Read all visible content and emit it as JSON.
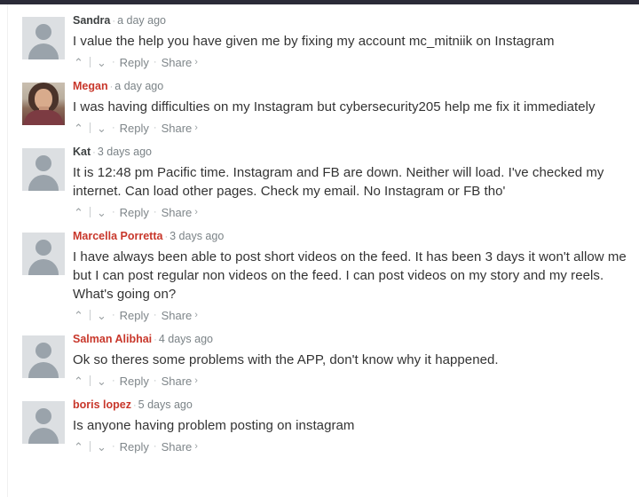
{
  "page": {
    "title": "Comment thread",
    "accent_red": "#c8372b",
    "text_color": "#333333",
    "meta_color": "#7b8387",
    "top_strip_color": "#2b2b38"
  },
  "actions": {
    "upvote_icon": "chevron-up-icon",
    "downvote_icon": "chevron-down-icon",
    "upvote_glyph": "⌃",
    "downvote_glyph": "⌄",
    "dot": "·",
    "reply_label": "Reply",
    "share_label": "Share",
    "share_caret": "›"
  },
  "comments": [
    {
      "author": "Sandra",
      "author_is_link": false,
      "timestamp": "a day ago",
      "avatar_type": "placeholder",
      "text": "I value the help you have given me by fixing my account mc_mitniik on Instagram"
    },
    {
      "author": "Megan",
      "author_is_link": true,
      "timestamp": "a day ago",
      "avatar_type": "photo",
      "text": "I was having difficulties on my Instagram but cybersecurity205 help me fix it immediately"
    },
    {
      "author": "Kat",
      "author_is_link": false,
      "timestamp": "3 days ago",
      "avatar_type": "placeholder",
      "text": "It is 12:48 pm Pacific time. Instagram and FB are down. Neither will load. I've checked my internet. Can load other pages. Check my email. No Instagram or FB tho'"
    },
    {
      "author": "Marcella Porretta",
      "author_is_link": true,
      "timestamp": "3 days ago",
      "avatar_type": "placeholder",
      "text": "I have always been able to post short videos on the feed. It has been 3 days it won't allow me but I can post regular non videos on the feed. I can post videos on my story and my reels. What's going on?"
    },
    {
      "author": "Salman Alibhai",
      "author_is_link": true,
      "timestamp": "4 days ago",
      "avatar_type": "placeholder",
      "text": "Ok so theres some problems with the APP, don't know why it happened."
    },
    {
      "author": "boris lopez",
      "author_is_link": true,
      "timestamp": "5 days ago",
      "avatar_type": "placeholder",
      "text": "Is anyone having problem posting on instagram"
    }
  ]
}
